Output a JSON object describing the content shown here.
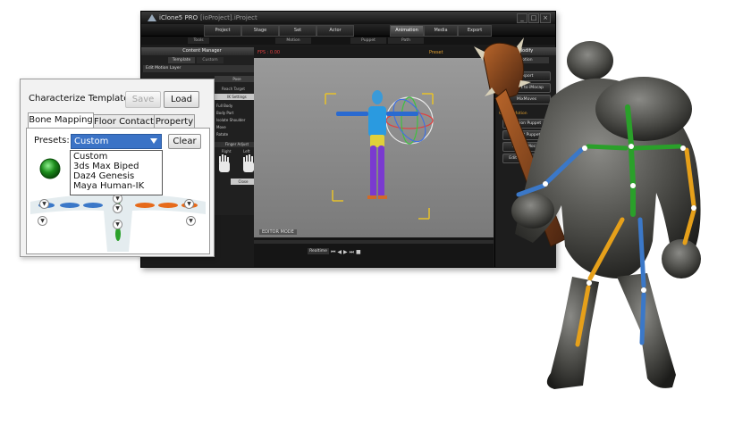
{
  "app": {
    "window_title": "iClone5 PRO",
    "project_name": "[ioProject].iProject",
    "tabs": [
      "Project",
      "Stage",
      "Set",
      "Actor",
      "Animation",
      "Media",
      "Export"
    ],
    "active_tab": "Animation",
    "subtabs": [
      "Tools",
      "Motion",
      "Puppet",
      "Path"
    ],
    "content_manager": {
      "title": "Content Manager",
      "tabs": [
        "Template",
        "Custom"
      ],
      "edit_motion_layer": "Edit Motion Layer",
      "pose": "Pose",
      "reach_target": "Reach Target",
      "ik_settings": "IK Settings",
      "list_items": [
        "Full Body",
        "Body Part",
        "Isolate Shoulder",
        "Move",
        "Rotate"
      ],
      "finger_adjust": "Finger Adjust",
      "hands": [
        "Right",
        "Left"
      ],
      "close": "Close"
    },
    "viewport": {
      "fps": "FPS : 0.00",
      "preset_label": "Preset",
      "mode": "EDITOR MODE"
    },
    "timeline": {
      "realtime": "Realtime"
    },
    "right_panel": {
      "title": "Modify",
      "motion_tab": "Motion",
      "motion_label": "Motion",
      "buttons": [
        "Export",
        "Export to iMocap",
        "MixMoves",
        "Motion Puppet",
        "Direct Puppet",
        "Device Mocap",
        "Edit Motion Layer"
      ],
      "motion_section": "Create Motion"
    },
    "colors": {
      "accent": "#e2a030",
      "window": "#1b1b1b",
      "viewport": "#8d8d8d"
    }
  },
  "dialog": {
    "title": "Characterize Template",
    "save_label": "Save",
    "load_label": "Load",
    "tabs": [
      "Bone Mapping",
      "Floor Contact",
      "Property"
    ],
    "active_tab": "Bone Mapping",
    "presets_label": "Presets:",
    "preset_value": "Custom",
    "clear_label": "Clear",
    "preset_options": [
      "Custom",
      "3ds Max Biped",
      "Daz4 Genesis",
      "Maya Human-IK"
    ],
    "status_color": "#1a8a1a",
    "bone_colors": {
      "left": "#3b78c8",
      "right": "#e66a1a",
      "spine": "#2aa02a"
    }
  }
}
